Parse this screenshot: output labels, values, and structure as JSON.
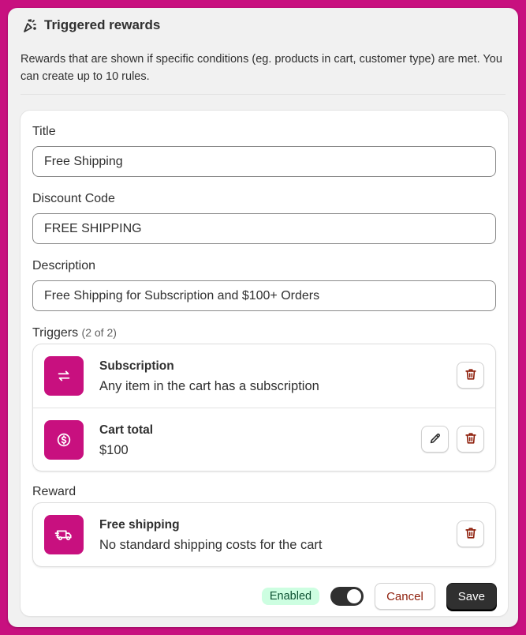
{
  "header": {
    "title": "Triggered rewards",
    "icon": "confetti-icon"
  },
  "intro": "Rewards that are shown if specific conditions (eg. products in cart, customer type) are met. You can create up to 10 rules.",
  "form": {
    "title_label": "Title",
    "title_value": "Free Shipping",
    "discount_label": "Discount Code",
    "discount_value": "FREE SHIPPING",
    "description_label": "Description",
    "description_value": "Free Shipping for Subscription and $100+ Orders"
  },
  "triggers": {
    "label": "Triggers",
    "count": "(2 of 2)",
    "items": [
      {
        "title": "Subscription",
        "subtitle": "Any item in the cart has a subscription",
        "icon": "repeat-icon"
      },
      {
        "title": "Cart total",
        "subtitle": "$100",
        "icon": "dollar-circle-icon"
      }
    ]
  },
  "reward": {
    "label": "Reward",
    "title": "Free shipping",
    "subtitle": "No standard shipping costs for the cart",
    "icon": "delivery-truck-icon"
  },
  "footer": {
    "status": "Enabled",
    "toggle_on": true,
    "cancel_label": "Cancel",
    "save_label": "Save"
  },
  "colors": {
    "accent": "#c8107f",
    "badge_bg": "#cdfee1",
    "badge_text": "#0c5132",
    "danger": "#8e1f0b",
    "primary": "#303030"
  }
}
